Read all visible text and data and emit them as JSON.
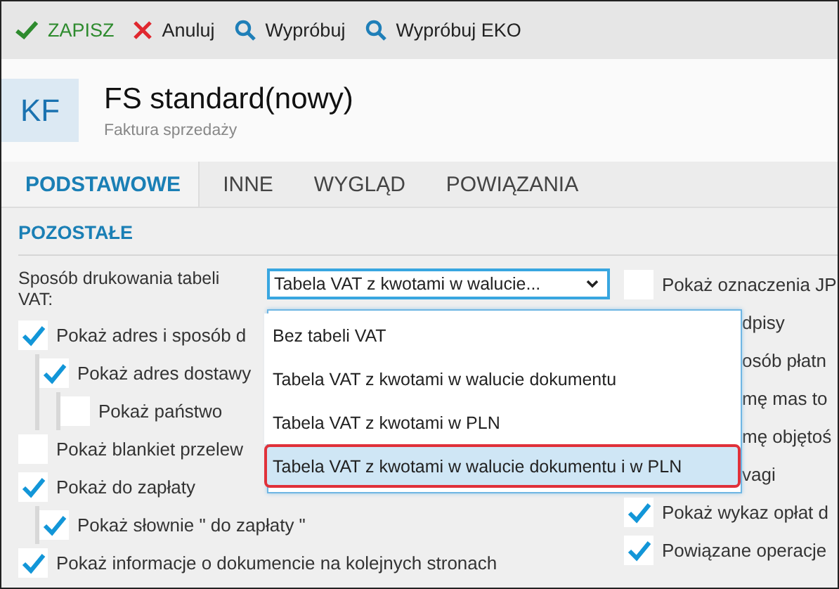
{
  "toolbar": [
    {
      "kind": "save",
      "label": "ZAPISZ"
    },
    {
      "kind": "cancel",
      "label": "Anuluj"
    },
    {
      "kind": "test",
      "label": "Wypróbuj"
    },
    {
      "kind": "test",
      "label": "Wypróbuj EKO"
    }
  ],
  "header": {
    "badge": "KF",
    "title": "FS standard(nowy)",
    "subtitle": "Faktura sprzedaży"
  },
  "tabs": [
    {
      "label": "PODSTAWOWE",
      "selected": true
    },
    {
      "label": "INNE",
      "selected": false
    },
    {
      "label": "WYGLĄD",
      "selected": false
    },
    {
      "label": "POWIĄZANIA",
      "selected": false
    }
  ],
  "section_title": "POZOSTAŁE",
  "vat_table": {
    "label": "Sposób drukowania tabeli VAT:",
    "value": "Tabela VAT z kwotami w walucie...",
    "options": [
      {
        "label": "Bez tabeli VAT",
        "selected": false
      },
      {
        "label": "Tabela VAT z kwotami w walucie dokumentu",
        "selected": false
      },
      {
        "label": "Tabela VAT z kwotami w PLN",
        "selected": false
      },
      {
        "label": "Tabela VAT z kwotami w walucie dokumentu i w PLN",
        "selected": true
      }
    ]
  },
  "left_options": [
    {
      "label": "Pokaż adres i sposób d",
      "checked": true,
      "children": [
        {
          "label": "Pokaż adres dostawy",
          "checked": true,
          "children": [
            {
              "label": "Pokaż państwo",
              "checked": false
            }
          ]
        }
      ]
    },
    {
      "label": "Pokaż blankiet przelew",
      "checked": false
    },
    {
      "label": "Pokaż do zapłaty",
      "checked": true,
      "children": [
        {
          "label": "Pokaż słownie \" do zapłaty \"",
          "checked": true
        }
      ]
    },
    {
      "label": "Pokaż informacje o dokumencie na kolejnych stronach",
      "checked": true
    }
  ],
  "right_options": [
    {
      "kind": "checkbox",
      "label": "Pokaż oznaczenia JP",
      "checked": false
    },
    {
      "kind": "covered",
      "label": "dpisy"
    },
    {
      "kind": "covered",
      "label": "osób płatn"
    },
    {
      "kind": "covered",
      "label": "mę mas to"
    },
    {
      "kind": "covered",
      "label": "mę objętoś"
    },
    {
      "kind": "covered",
      "label": "vagi"
    },
    {
      "kind": "checkbox",
      "label": "Pokaż wykaz opłat d",
      "checked": true
    },
    {
      "kind": "checkbox",
      "label": "Powiązane operacje",
      "checked": true
    }
  ]
}
